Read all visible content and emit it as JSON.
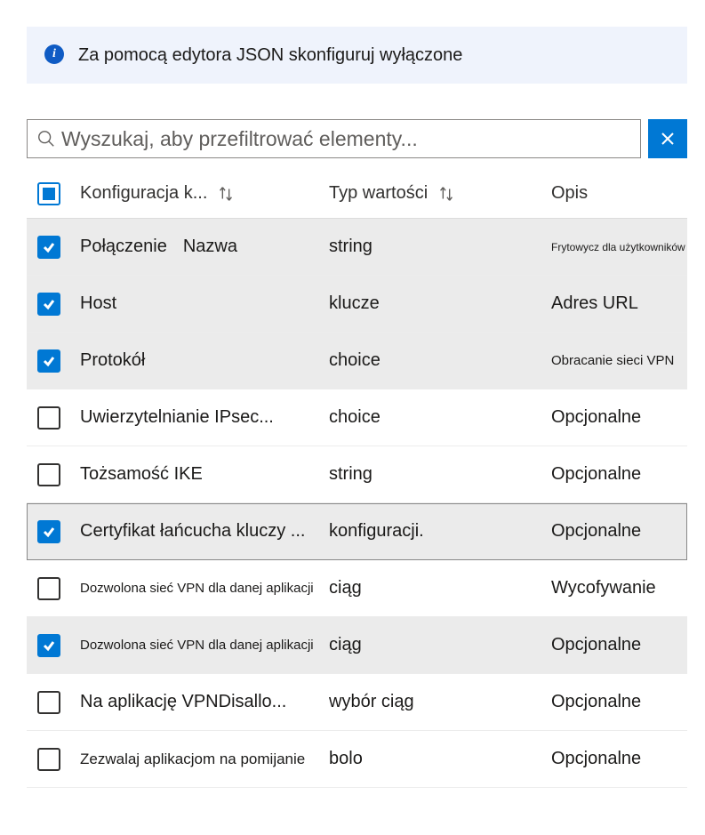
{
  "banner": {
    "text": "Za pomocą edytora JSON skonfiguruj wyłączone"
  },
  "search": {
    "placeholder": "Wyszukaj, aby przefiltrować elementy..."
  },
  "columns": {
    "key": "Konfiguracja k...",
    "type": "Typ wartości",
    "desc": "Opis"
  },
  "rows": [
    {
      "checked": true,
      "key": "Połączenie",
      "key2": "Nazwa",
      "type": "string",
      "desc": "Frytowycz dla użytkowników",
      "descSize": "small"
    },
    {
      "checked": true,
      "key": "Host",
      "type": "klucze",
      "desc": "Adres URL"
    },
    {
      "checked": true,
      "key": "Protokół",
      "type": "choice",
      "desc": "Obracanie sieci VPN",
      "descSize": "med"
    },
    {
      "checked": false,
      "key": "Uwierzytelnianie IPsec...",
      "type": "choice",
      "desc": "Opcjonalne"
    },
    {
      "checked": false,
      "key": "Tożsamość IKE",
      "type": "string",
      "desc": "Opcjonalne"
    },
    {
      "checked": true,
      "key": "Certyfikat łańcucha kluczy ...",
      "type": "konfiguracji.",
      "desc": "Opcjonalne",
      "focused": true
    },
    {
      "checked": false,
      "key": "Dozwolona sieć VPN dla danej aplikacji",
      "keySmall": true,
      "type": "ciąg",
      "desc": "Wycofywanie"
    },
    {
      "checked": true,
      "key": "Dozwolona sieć VPN dla danej aplikacji",
      "keySmall": true,
      "type": "ciąg",
      "desc": "Opcjonalne"
    },
    {
      "checked": false,
      "key": "Na aplikację VPNDisallo...",
      "type": "wybór ciąg",
      "desc": "Opcjonalne"
    },
    {
      "checked": false,
      "key": "Zezwalaj aplikacjom na pomijanie",
      "keyMed": true,
      "type": "bolo",
      "desc": "Opcjonalne"
    }
  ]
}
